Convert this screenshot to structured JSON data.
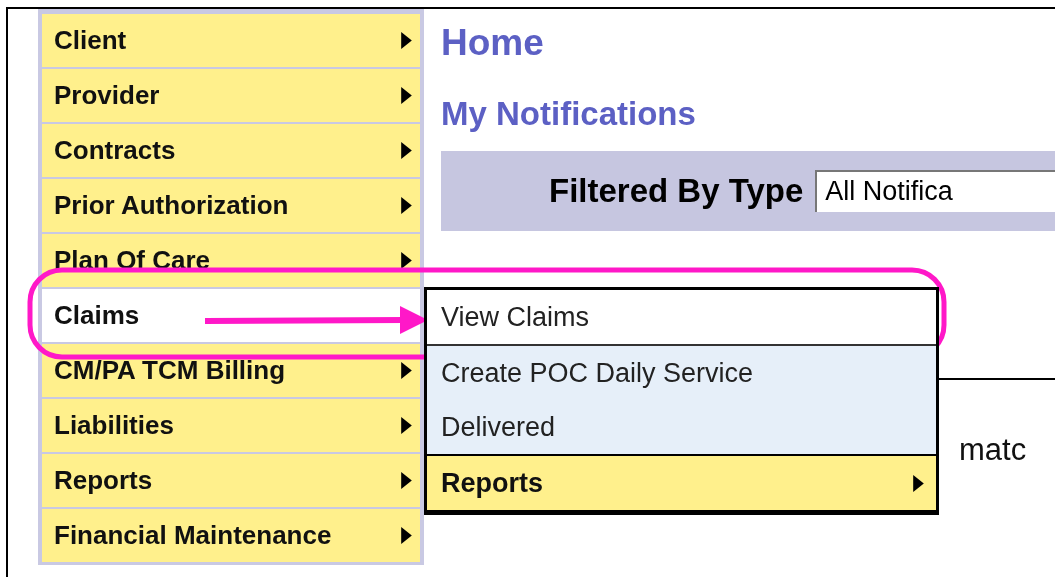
{
  "menu": [
    {
      "label": "Client",
      "arrow": true,
      "selected": false
    },
    {
      "label": "Provider",
      "arrow": true,
      "selected": false
    },
    {
      "label": "Contracts",
      "arrow": true,
      "selected": false
    },
    {
      "label": "Prior Authorization",
      "arrow": true,
      "selected": false
    },
    {
      "label": "Plan Of Care",
      "arrow": true,
      "selected": false
    },
    {
      "label": "Claims",
      "arrow": false,
      "selected": true,
      "submenu": [
        {
          "label": "View Claims",
          "kind": "link",
          "selected": true
        },
        {
          "label": "Create POC Daily Service",
          "kind": "link",
          "selected": false
        },
        {
          "label": "Delivered",
          "kind": "link",
          "selected": false
        },
        {
          "label": "Reports",
          "kind": "submenu",
          "selected": false
        }
      ]
    },
    {
      "label": "CM/PA TCM Billing",
      "arrow": true,
      "selected": false
    },
    {
      "label": "Liabilities",
      "arrow": true,
      "selected": false
    },
    {
      "label": "Reports",
      "arrow": true,
      "selected": false
    },
    {
      "label": "Financial Maintenance",
      "arrow": true,
      "selected": false
    }
  ],
  "page": {
    "title": "Home",
    "subtitle": "My Notifications",
    "filter": {
      "label": "Filtered By Type",
      "value": "All Notifica"
    },
    "message": "matc"
  },
  "annotation": {
    "kind": "outline-arrow"
  }
}
